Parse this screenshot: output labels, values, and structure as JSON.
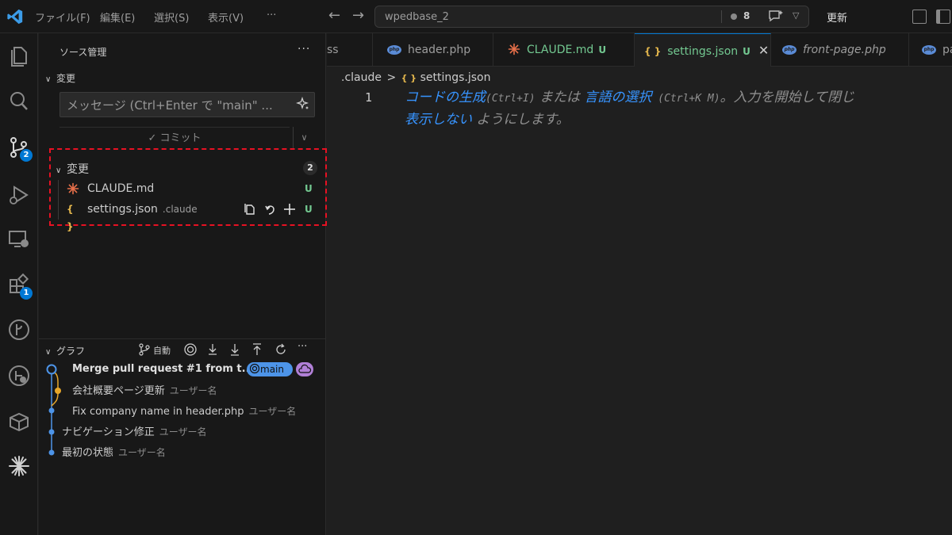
{
  "titlebar": {
    "menu": [
      "ファイル(F)",
      "編集(E)",
      "選択(S)",
      "表示(V)",
      "···"
    ],
    "search": "wpedbase_2",
    "problem_count": "8",
    "update_label": "更新"
  },
  "activitybar": {
    "scm_badge": "2",
    "extensions_badge": "1"
  },
  "sidebar": {
    "title": "ソース管理",
    "more": "···",
    "changes_section": "変更",
    "message_placeholder": "メッセージ (Ctrl+Enter で \"main\" ...",
    "commit_label": "✓ コミット",
    "changes_group": {
      "label": "変更",
      "count": "2",
      "files": [
        {
          "name": "CLAUDE.md",
          "dir": "",
          "status": "U"
        },
        {
          "name": "settings.json",
          "dir": ".claude",
          "status": "U"
        }
      ]
    },
    "graph": {
      "label": "グラフ",
      "auto_label": "自動",
      "commits": [
        {
          "message": "Merge pull request #1 from t...",
          "author": "",
          "branch": "main"
        },
        {
          "message": "会社概要ページ更新",
          "author": "ユーザー名",
          "branch": ""
        },
        {
          "message": "Fix company name in header.php",
          "author": "ユーザー名",
          "branch": ""
        },
        {
          "message": "ナビゲーション修正",
          "author": "ユーザー名",
          "branch": ""
        },
        {
          "message": "最初の状態",
          "author": "ユーザー名",
          "branch": ""
        }
      ]
    }
  },
  "tabs": [
    {
      "label": "ss",
      "status": "",
      "icon": "none",
      "italic": false,
      "active": false
    },
    {
      "label": "header.php",
      "status": "",
      "icon": "php",
      "italic": false,
      "active": false
    },
    {
      "label": "CLAUDE.md",
      "status": "U",
      "icon": "claude",
      "italic": false,
      "active": false
    },
    {
      "label": "settings.json",
      "status": "U",
      "icon": "json",
      "italic": false,
      "active": true
    },
    {
      "label": "front-page.php",
      "status": "",
      "icon": "php",
      "italic": true,
      "active": false
    },
    {
      "label": "pa",
      "status": "",
      "icon": "php",
      "italic": false,
      "active": false
    }
  ],
  "editor": {
    "breadcrumb_folder": ".claude",
    "breadcrumb_file": "settings.json",
    "line_number": "1",
    "hint": {
      "generate_link": "コードの生成",
      "generate_key": "(Ctrl+I)",
      "or_text": " または ",
      "language_link": "言語の選択",
      "language_key": " (Ctrl+K M)",
      "rest": "。入力を開始して閉じ",
      "dont_show_link": "表示しない",
      "suffix": " ようにします。"
    }
  },
  "colors": {
    "accent": "#0078d4",
    "untracked": "#73c991",
    "highlight_box": "#e81123",
    "link": "#3794ff"
  }
}
